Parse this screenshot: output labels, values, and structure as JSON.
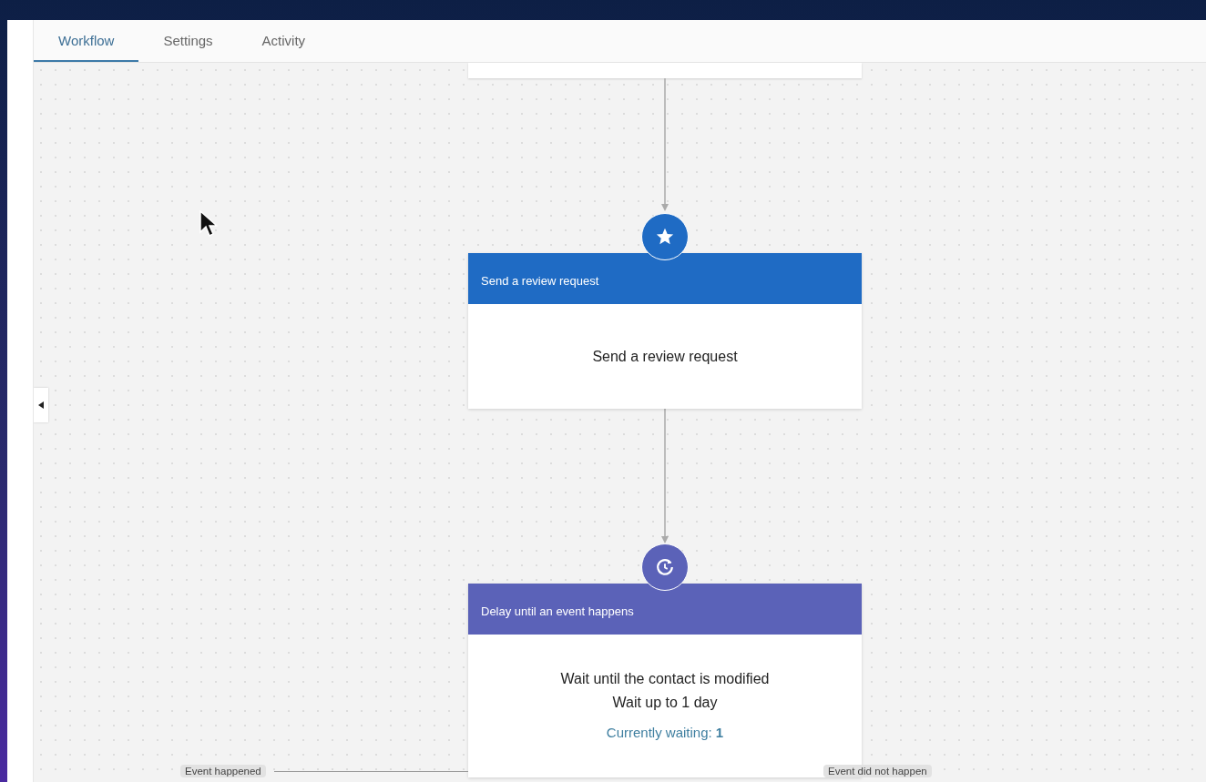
{
  "tabs": [
    {
      "label": "Workflow",
      "selected": true
    },
    {
      "label": "Settings",
      "selected": false
    },
    {
      "label": "Activity",
      "selected": false
    }
  ],
  "nodes": [
    {
      "kind": "action",
      "header": "Send a review request",
      "body": [
        "Send a review request"
      ]
    },
    {
      "kind": "delay",
      "header": "Delay until an event happens",
      "body": [
        "Wait until the contact is modified",
        "Wait up to 1 day"
      ],
      "status": {
        "label": "Currently waiting:",
        "count": "1"
      }
    }
  ],
  "branches": [
    {
      "label": "Event happened"
    },
    {
      "label": "Event did not happen"
    }
  ]
}
